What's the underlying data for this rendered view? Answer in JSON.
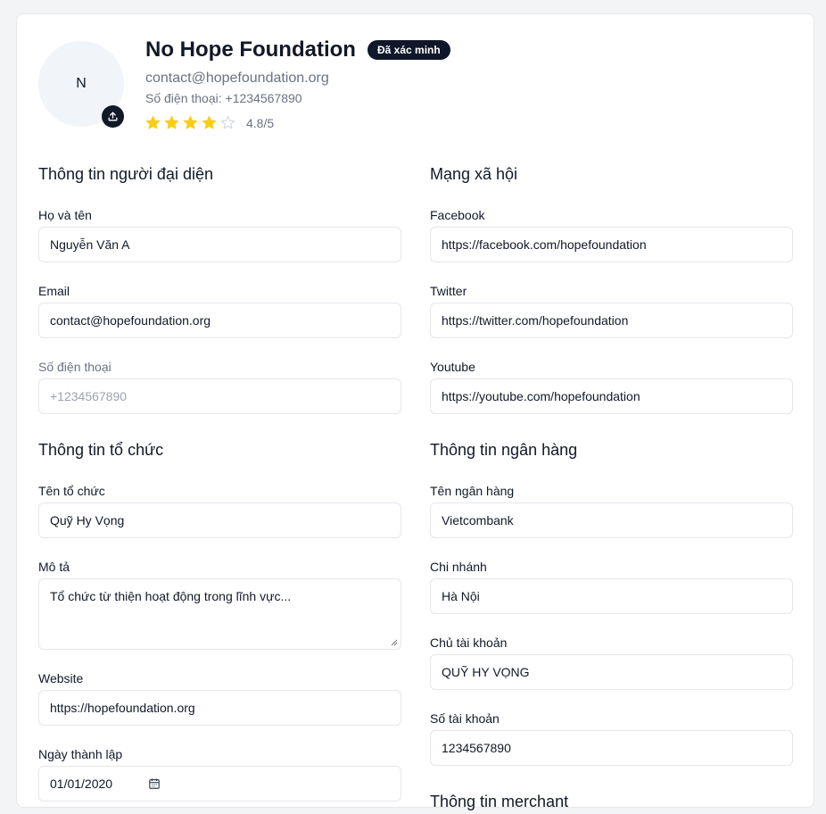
{
  "header": {
    "avatar_initial": "N",
    "org_name": "No Hope Foundation",
    "badge": "Đã xác minh",
    "email": "contact@hopefoundation.org",
    "phone_label": "Số điện thoại:",
    "phone_value": "+1234567890",
    "rating_value": "4.8/5",
    "rating": 4.8,
    "rating_max": 5
  },
  "representative": {
    "title": "Thông tin người đại diện",
    "name_label": "Họ và tên",
    "name_value": "Nguyễn Văn A",
    "email_label": "Email",
    "email_value": "contact@hopefoundation.org",
    "phone_label": "Số điện thoại",
    "phone_value": "+1234567890"
  },
  "organization": {
    "title": "Thông tin tổ chức",
    "org_label": "Tên tổ chức",
    "org_value": "Quỹ Hy Vọng",
    "desc_label": "Mô tả",
    "desc_value": "Tổ chức từ thiện hoạt động trong lĩnh vực...",
    "website_label": "Website",
    "website_value": "https://hopefoundation.org",
    "founded_label": "Ngày thành lập",
    "founded_value": "01/01/2020"
  },
  "social": {
    "title": "Mạng xã hội",
    "facebook_label": "Facebook",
    "facebook_value": "https://facebook.com/hopefoundation",
    "twitter_label": "Twitter",
    "twitter_value": "https://twitter.com/hopefoundation",
    "youtube_label": "Youtube",
    "youtube_value": "https://youtube.com/hopefoundation"
  },
  "bank": {
    "title": "Thông tin ngân hàng",
    "bank_label": "Tên ngân hàng",
    "bank_value": "Vietcombank",
    "branch_label": "Chi nhánh",
    "branch_value": "Hà Nội",
    "holder_label": "Chủ tài khoản",
    "holder_value": "QUỸ HY VỌNG",
    "account_label": "Số tài khoản",
    "account_value": "1234567890"
  },
  "merchant": {
    "title": "Thông tin merchant"
  },
  "icons": {
    "upload": "upload-icon",
    "star": "star-icon",
    "calendar": "calendar-icon"
  },
  "colors": {
    "star_filled": "#facc15",
    "star_empty": "#d1d5db",
    "badge_bg": "#0f172a"
  }
}
